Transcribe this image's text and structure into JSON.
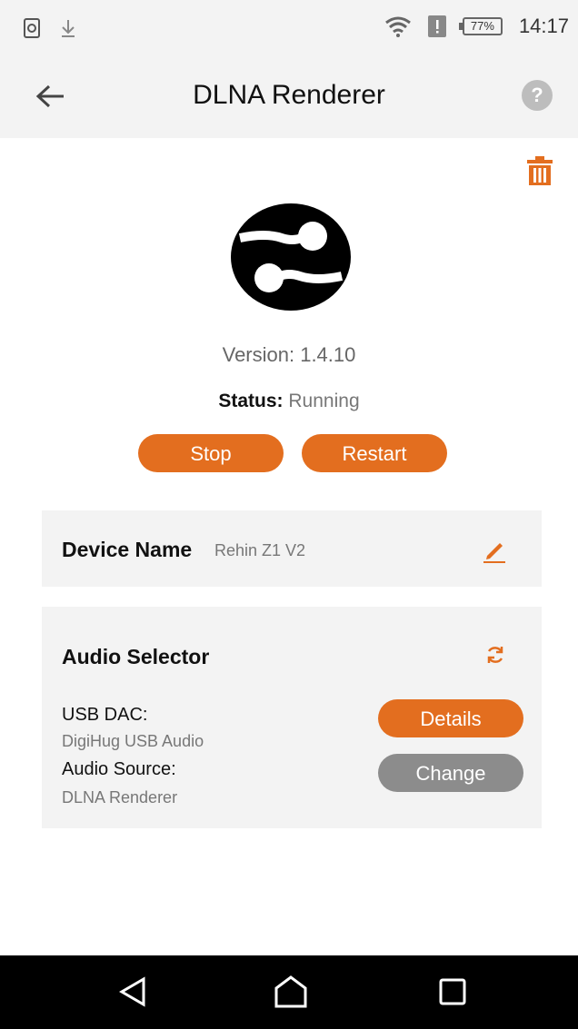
{
  "statusbar": {
    "time": "14:17",
    "battery": "77%"
  },
  "appbar": {
    "title": "DLNA Renderer"
  },
  "info": {
    "version": "Version: 1.4.10",
    "status_label": "Status:",
    "status_value": "Running"
  },
  "controls": {
    "stop_label": "Stop",
    "restart_label": "Restart"
  },
  "device": {
    "label": "Device Name",
    "value": "Rehin Z1 V2"
  },
  "audio": {
    "title": "Audio Selector",
    "usb_label": "USB DAC:",
    "usb_value": "DigiHug USB Audio",
    "source_label": "Audio Source:",
    "source_value": "DLNA Renderer",
    "details_label": "Details",
    "change_label": "Change"
  },
  "colors": {
    "accent": "#e36e1f",
    "disabled": "#8c8c8c",
    "card_bg": "#f3f3f3"
  },
  "icons": [
    "back-arrow-icon",
    "help-icon",
    "trash-icon",
    "edit-icon",
    "refresh-icon",
    "nav-back-icon",
    "nav-home-icon",
    "nav-recent-icon"
  ]
}
